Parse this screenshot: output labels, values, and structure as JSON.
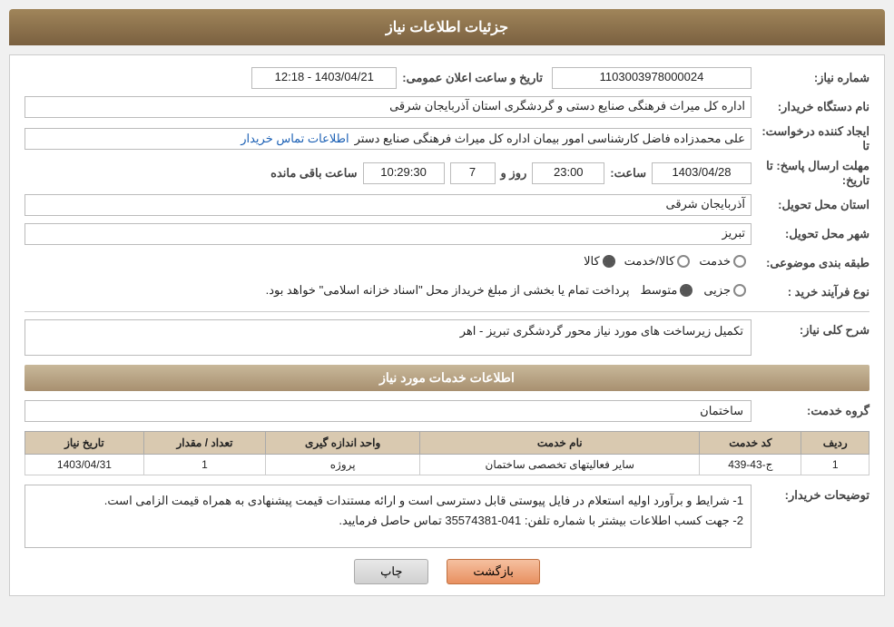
{
  "page": {
    "header": "جزئیات اطلاعات نیاز",
    "section1_title": "اطلاعات خدمات مورد نیاز"
  },
  "fields": {
    "need_number_label": "شماره نیاز:",
    "need_number_value": "1103003978000024",
    "buyer_org_label": "نام دستگاه خریدار:",
    "buyer_org_value": "اداره کل میراث فرهنگی  صنایع دستی و گردشگری استان آذربایجان شرقی",
    "creator_label": "ایجاد کننده درخواست: تا",
    "creator_value": "علی محمدزاده فاضل کارشناسی امور بیمان اداره کل میراث فرهنگی  صنایع دستر",
    "creator_link": "اطلاعات تماس خریدار",
    "deadline_label": "مهلت ارسال پاسخ: تا تاریخ:",
    "deadline_date": "1403/04/28",
    "deadline_time_label": "ساعت:",
    "deadline_time": "23:00",
    "deadline_days_label": "روز و",
    "deadline_days": "7",
    "deadline_remain_label": "ساعت باقی مانده",
    "deadline_remain": "10:29:30",
    "province_label": "استان محل تحویل:",
    "province_value": "آذربایجان شرقی",
    "city_label": "شهر محل تحویل:",
    "city_value": "تبریز",
    "category_label": "طبقه بندی موضوعی:",
    "category_options": [
      "خدمت",
      "کالا/خدمت",
      "کالا"
    ],
    "category_selected": "کالا",
    "process_label": "نوع فرآیند خرید :",
    "process_options": [
      "جزیی",
      "متوسط"
    ],
    "process_selected": "متوسط",
    "process_desc": "پرداخت تمام یا بخشی از مبلغ خریداز محل \"اسناد خزانه اسلامی\" خواهد بود.",
    "need_desc_label": "شرح کلی نیاز:",
    "need_desc_value": "تکمیل زیرساخت های مورد نیاز محور گردشگری تبریز - اهر",
    "service_group_label": "گروه خدمت:",
    "service_group_value": "ساختمان",
    "table": {
      "headers": [
        "ردیف",
        "کد خدمت",
        "نام خدمت",
        "واحد اندازه گیری",
        "تعداد / مقدار",
        "تاریخ نیاز"
      ],
      "rows": [
        {
          "row": "1",
          "code": "ج-43-439",
          "name": "سایر فعالیتهای تخصصی ساختمان",
          "unit": "پروژه",
          "count": "1",
          "date": "1403/04/31"
        }
      ]
    },
    "notes_label": "توضیحات خریدار:",
    "notes_line1": "1- شرایط و برآورد اولیه استعلام در فایل پیوستی قابل دسترسی است و ارائه مستندات قیمت پیشنهادی به همراه قیمت الزامی است.",
    "notes_line2": "2- جهت کسب اطلاعات بیشتر  با شماره تلفن: 041-35574381  تماس حاصل فرمایید.",
    "btn_print": "چاپ",
    "btn_back": "بازگشت",
    "announce_label": "تاریخ و ساعت اعلان عمومی:",
    "announce_value": "1403/04/21 - 12:18"
  }
}
